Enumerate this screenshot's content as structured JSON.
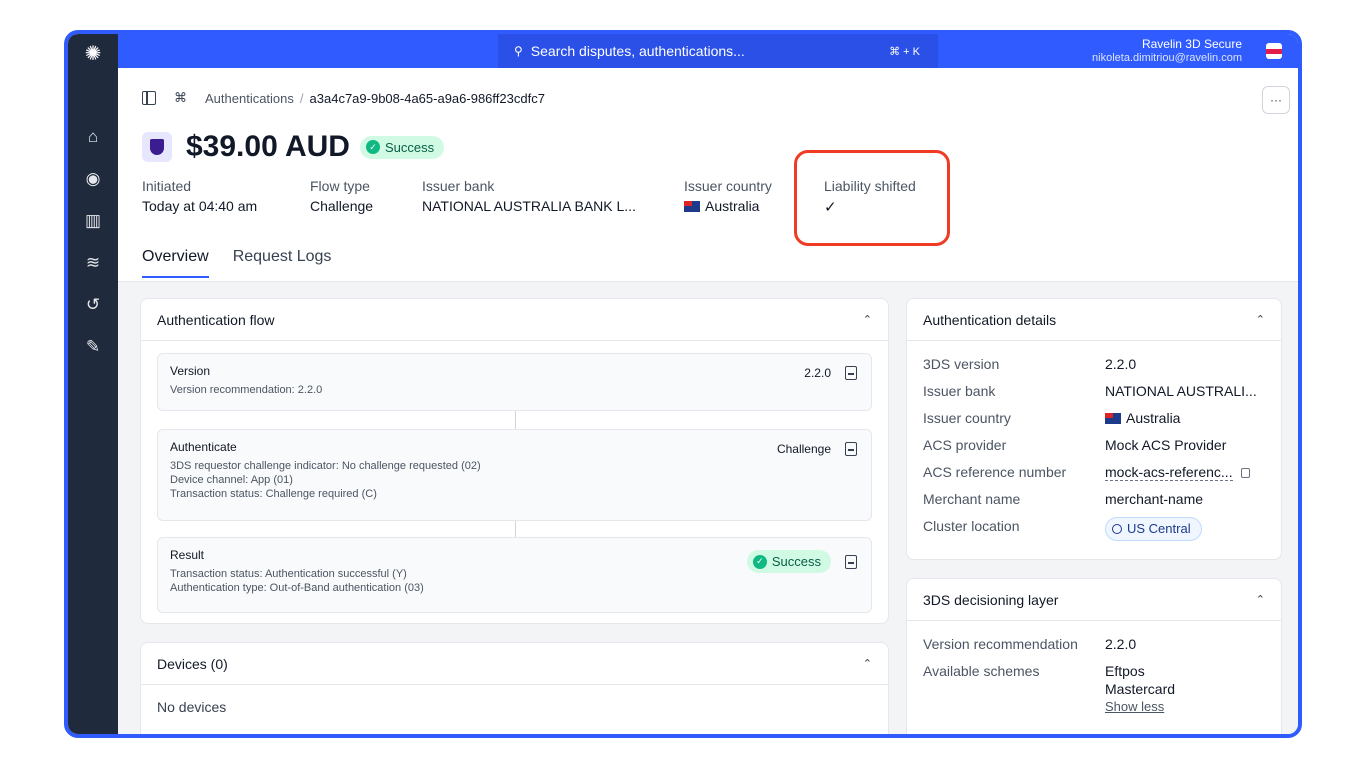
{
  "topbar": {
    "search_placeholder": "Search disputes, authentications...",
    "shortcut": "⌘ + K",
    "org_name": "Ravelin 3D Secure",
    "user_email": "nikoleta.dimitriou@ravelin.com"
  },
  "sidebar": {
    "items": [
      {
        "name": "home",
        "icon": "⌂"
      },
      {
        "name": "explore",
        "icon": "◉"
      },
      {
        "name": "analytics",
        "icon": "▥"
      },
      {
        "name": "data",
        "icon": "≋"
      },
      {
        "name": "history",
        "icon": "↺"
      },
      {
        "name": "settings",
        "icon": "✎"
      }
    ]
  },
  "breadcrumb": {
    "parent": "Authentications",
    "separator": "/",
    "current": "a3a4c7a9-9b08-4a65-a9a6-986ff23cdfc7"
  },
  "header": {
    "amount": "$39.00 AUD",
    "status": "Success",
    "more": "···"
  },
  "meta": {
    "initiated_label": "Initiated",
    "initiated_value": "Today at 04:40 am",
    "flow_label": "Flow type",
    "flow_value": "Challenge",
    "bank_label": "Issuer bank",
    "bank_value": "NATIONAL AUSTRALIA BANK L...",
    "country_label": "Issuer country",
    "country_value": "Australia",
    "liability_label": "Liability shifted",
    "liability_value": "✓"
  },
  "tabs": [
    "Overview",
    "Request Logs"
  ],
  "auth_flow": {
    "title": "Authentication flow",
    "steps": [
      {
        "title": "Version",
        "right": "2.2.0",
        "lines": [
          "Version recommendation: 2.2.0"
        ]
      },
      {
        "title": "Authenticate",
        "right": "Challenge",
        "lines": [
          "3DS requestor challenge indicator: No challenge requested (02)",
          "Device channel: App (01)",
          "Transaction status: Challenge required (C)"
        ]
      },
      {
        "title": "Result",
        "right": "Success",
        "lines": [
          "Transaction status: Authentication successful (Y)",
          "Authentication type: Out-of-Band authentication (03)"
        ]
      }
    ]
  },
  "devices": {
    "title": "Devices (0)",
    "empty": "No devices"
  },
  "auth_details": {
    "title": "Authentication details",
    "rows": [
      {
        "k": "3DS version",
        "v": "2.2.0"
      },
      {
        "k": "Issuer bank",
        "v": "NATIONAL AUSTRALI..."
      },
      {
        "k": "Issuer country",
        "v": "Australia"
      },
      {
        "k": "ACS provider",
        "v": "Mock ACS Provider"
      },
      {
        "k": "ACS reference number",
        "v": "mock-acs-referenc..."
      },
      {
        "k": "Merchant name",
        "v": "merchant-name"
      },
      {
        "k": "Cluster location",
        "v": "US Central"
      }
    ]
  },
  "decisioning": {
    "title": "3DS decisioning layer",
    "version_label": "Version recommendation",
    "version_value": "2.2.0",
    "schemes_label": "Available schemes",
    "schemes": [
      "Eftpos",
      "Mastercard"
    ],
    "show_less": "Show less"
  },
  "colors": {
    "brand": "#2f5bff",
    "sidebar": "#1f2b3d",
    "success": "#10b981",
    "highlight": "#ef3b24"
  }
}
